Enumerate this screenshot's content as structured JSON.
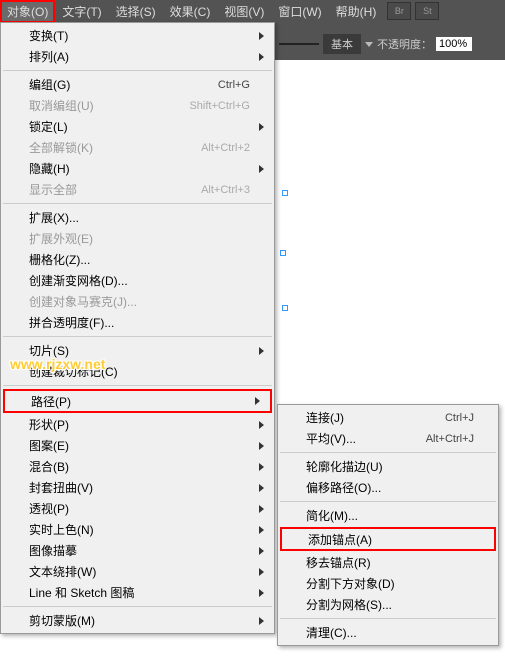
{
  "menubar": {
    "items": [
      {
        "label": "对象(O)"
      },
      {
        "label": "文字(T)"
      },
      {
        "label": "选择(S)"
      },
      {
        "label": "效果(C)"
      },
      {
        "label": "视图(V)"
      },
      {
        "label": "窗口(W)"
      },
      {
        "label": "帮助(H)"
      }
    ],
    "icons": [
      {
        "label": "Br"
      },
      {
        "label": "St"
      }
    ]
  },
  "toolbar": {
    "basic_label": "基本",
    "opacity_label": "不透明度：",
    "opacity_value": "100%"
  },
  "main_menu": [
    {
      "type": "item",
      "label": "变换(T)",
      "submenu": true
    },
    {
      "type": "item",
      "label": "排列(A)",
      "submenu": true
    },
    {
      "type": "sep"
    },
    {
      "type": "item",
      "label": "编组(G)",
      "shortcut": "Ctrl+G"
    },
    {
      "type": "item",
      "label": "取消编组(U)",
      "shortcut": "Shift+Ctrl+G",
      "disabled": true
    },
    {
      "type": "item",
      "label": "锁定(L)",
      "submenu": true
    },
    {
      "type": "item",
      "label": "全部解锁(K)",
      "shortcut": "Alt+Ctrl+2",
      "disabled": true
    },
    {
      "type": "item",
      "label": "隐藏(H)",
      "submenu": true
    },
    {
      "type": "item",
      "label": "显示全部",
      "shortcut": "Alt+Ctrl+3",
      "disabled": true
    },
    {
      "type": "sep"
    },
    {
      "type": "item",
      "label": "扩展(X)..."
    },
    {
      "type": "item",
      "label": "扩展外观(E)",
      "disabled": true
    },
    {
      "type": "item",
      "label": "栅格化(Z)..."
    },
    {
      "type": "item",
      "label": "创建渐变网格(D)..."
    },
    {
      "type": "item",
      "label": "创建对象马赛克(J)...",
      "disabled": true
    },
    {
      "type": "item",
      "label": "拼合透明度(F)..."
    },
    {
      "type": "sep"
    },
    {
      "type": "item",
      "label": "切片(S)",
      "submenu": true
    },
    {
      "type": "item",
      "label": "创建裁切标记(C)"
    },
    {
      "type": "sep"
    },
    {
      "type": "item",
      "label": "路径(P)",
      "submenu": true,
      "highlighted": true
    },
    {
      "type": "item",
      "label": "形状(P)",
      "submenu": true
    },
    {
      "type": "item",
      "label": "图案(E)",
      "submenu": true
    },
    {
      "type": "item",
      "label": "混合(B)",
      "submenu": true
    },
    {
      "type": "item",
      "label": "封套扭曲(V)",
      "submenu": true
    },
    {
      "type": "item",
      "label": "透视(P)",
      "submenu": true
    },
    {
      "type": "item",
      "label": "实时上色(N)",
      "submenu": true
    },
    {
      "type": "item",
      "label": "图像描摹",
      "submenu": true
    },
    {
      "type": "item",
      "label": "文本绕排(W)",
      "submenu": true
    },
    {
      "type": "item",
      "label": "Line 和 Sketch 图稿",
      "submenu": true
    },
    {
      "type": "sep"
    },
    {
      "type": "item",
      "label": "剪切蒙版(M)",
      "submenu": true
    }
  ],
  "submenu": [
    {
      "type": "item",
      "label": "连接(J)",
      "shortcut": "Ctrl+J"
    },
    {
      "type": "item",
      "label": "平均(V)...",
      "shortcut": "Alt+Ctrl+J"
    },
    {
      "type": "sep"
    },
    {
      "type": "item",
      "label": "轮廓化描边(U)"
    },
    {
      "type": "item",
      "label": "偏移路径(O)..."
    },
    {
      "type": "sep"
    },
    {
      "type": "item",
      "label": "简化(M)..."
    },
    {
      "type": "item",
      "label": "添加锚点(A)",
      "highlighted": true
    },
    {
      "type": "item",
      "label": "移去锚点(R)"
    },
    {
      "type": "item",
      "label": "分割下方对象(D)"
    },
    {
      "type": "item",
      "label": "分割为网格(S)..."
    },
    {
      "type": "sep"
    },
    {
      "type": "item",
      "label": "清理(C)..."
    }
  ],
  "watermark": "www.rjzxw.net"
}
